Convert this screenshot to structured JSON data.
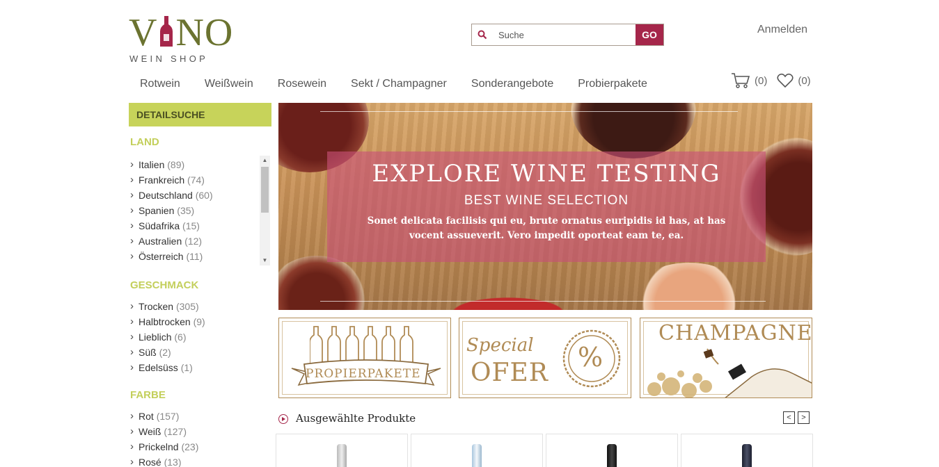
{
  "logo": {
    "word_left": "V",
    "word_right": "NO",
    "subtitle": "WEIN SHOP"
  },
  "search": {
    "placeholder": "Suche",
    "button_label": "GO"
  },
  "header": {
    "login_label": "Anmelden"
  },
  "nav": [
    "Rotwein",
    "Weißwein",
    "Rosewein",
    "Sekt / Champagner",
    "Sonderangebote",
    "Probierpakete"
  ],
  "cart": {
    "cart_count": "(0)",
    "wishlist_count": "(0)"
  },
  "sidebar": {
    "title": "DETAILSUCHE",
    "land": {
      "title": "LAND",
      "items": [
        {
          "name": "Italien",
          "count": "(89)"
        },
        {
          "name": "Frankreich",
          "count": "(74)"
        },
        {
          "name": "Deutschland",
          "count": "(60)"
        },
        {
          "name": "Spanien",
          "count": "(35)"
        },
        {
          "name": "Südafrika",
          "count": "(15)"
        },
        {
          "name": "Australien",
          "count": "(12)"
        },
        {
          "name": "Österreich",
          "count": "(11)"
        }
      ]
    },
    "geschmack": {
      "title": "GESCHMACK",
      "items": [
        {
          "name": "Trocken",
          "count": "(305)"
        },
        {
          "name": "Halbtrocken",
          "count": "(9)"
        },
        {
          "name": "Lieblich",
          "count": "(6)"
        },
        {
          "name": "Süß",
          "count": "(2)"
        },
        {
          "name": "Edelsüss",
          "count": "(1)"
        }
      ]
    },
    "farbe": {
      "title": "FARBE",
      "items": [
        {
          "name": "Rot",
          "count": "(157)"
        },
        {
          "name": "Weiß",
          "count": "(127)"
        },
        {
          "name": "Prickelnd",
          "count": "(23)"
        },
        {
          "name": "Rosé",
          "count": "(13)"
        }
      ]
    }
  },
  "banner": {
    "title": "EXPLORE WINE TESTING",
    "subtitle": "BEST WINE SELECTION",
    "text": "Sonet delicata facilisis qui eu, brute ornatus euripidis id has, at has vocent assueverit. Vero impedit oporteat eam te, ea."
  },
  "tiles": {
    "probier": "PROPIERPAKETE",
    "special_1": "Special",
    "special_2": "OFER",
    "percent": "%",
    "champagne": "CHAMPAGNE"
  },
  "featured": {
    "title": "Ausgewählte Produkte",
    "prev": "<",
    "next": ">"
  },
  "colors": {
    "accent": "#a5264a",
    "lime": "#c7d35a",
    "olive": "#6b7330",
    "gold": "#b08b55"
  }
}
